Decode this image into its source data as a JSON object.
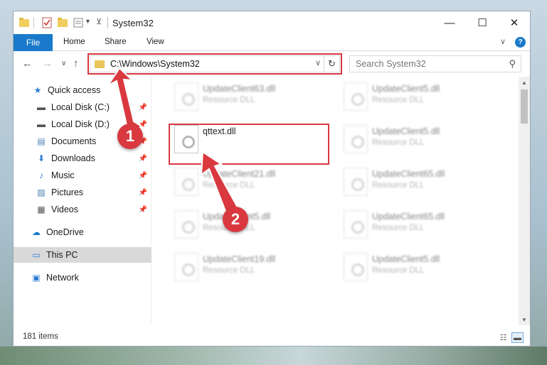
{
  "window": {
    "title": "System32",
    "minimize_glyph": "—",
    "maximize_glyph": "☐",
    "close_glyph": "✕"
  },
  "ribbon": {
    "tabs": [
      "File",
      "Home",
      "Share",
      "View"
    ],
    "expand_glyph": "∨",
    "help_glyph": "?"
  },
  "nav": {
    "back": "←",
    "forward": "→",
    "recent": "∨",
    "up": "↑"
  },
  "address": {
    "path": "C:\\Windows\\System32",
    "dropdown_glyph": "∨",
    "refresh_glyph": "↻"
  },
  "search": {
    "placeholder": "Search System32",
    "icon_glyph": "⚲"
  },
  "sidebar": {
    "items": [
      {
        "label": "Quick access",
        "icon": "star-icon",
        "glyph": "★",
        "color": "#2b7cd3",
        "pinned": false
      },
      {
        "label": "Local Disk (C:)",
        "icon": "drive-icon",
        "glyph": "▬",
        "color": "#555555",
        "pinned": true
      },
      {
        "label": "Local Disk (D:)",
        "icon": "drive-icon",
        "glyph": "▬",
        "color": "#555555",
        "pinned": true
      },
      {
        "label": "Documents",
        "icon": "documents-icon",
        "glyph": "▤",
        "color": "#4a7fb5",
        "pinned": true
      },
      {
        "label": "Downloads",
        "icon": "downloads-icon",
        "glyph": "⬇",
        "color": "#2b7cd3",
        "pinned": true
      },
      {
        "label": "Music",
        "icon": "music-icon",
        "glyph": "♪",
        "color": "#2b7cd3",
        "pinned": true
      },
      {
        "label": "Pictures",
        "icon": "pictures-icon",
        "glyph": "▨",
        "color": "#4a7fb5",
        "pinned": true
      },
      {
        "label": "Videos",
        "icon": "videos-icon",
        "glyph": "▦",
        "color": "#555555",
        "pinned": true
      },
      {
        "label": "OneDrive",
        "icon": "onedrive-icon",
        "glyph": "☁",
        "color": "#1979ca",
        "pinned": false
      },
      {
        "label": "This PC",
        "icon": "computer-icon",
        "glyph": "▭",
        "color": "#2b7cd3",
        "pinned": false,
        "selected": true
      },
      {
        "label": "Network",
        "icon": "network-icon",
        "glyph": "▣",
        "color": "#2b7cd3",
        "pinned": false
      }
    ],
    "pin_glyph": "📌"
  },
  "files": [
    {
      "name": "UpdateClient63.dll",
      "type": "Resource DLL",
      "blurred": true
    },
    {
      "name": "UpdateClient5.dll",
      "type": "Resource DLL",
      "blurred": true
    },
    {
      "name": "qttext.dll",
      "type": "",
      "blurred": false,
      "highlighted": true
    },
    {
      "name": "UpdateClient5.dll",
      "type": "Resource DLL",
      "blurred": true
    },
    {
      "name": "UpdateClient21.dll",
      "type": "Resource DLL",
      "blurred": true
    },
    {
      "name": "UpdateClient65.dll",
      "type": "Resource DLL",
      "blurred": true
    },
    {
      "name": "UpdateClient5.dll",
      "type": "Resource DLL",
      "blurred": true
    },
    {
      "name": "UpdateClient65.dll",
      "type": "Resource DLL",
      "blurred": true
    },
    {
      "name": "UpdateClient19.dll",
      "type": "Resource DLL",
      "blurred": true
    },
    {
      "name": "UpdateClient5.dll",
      "type": "Resource DLL",
      "blurred": true
    }
  ],
  "status": {
    "count": "181 items"
  },
  "callouts": [
    "1",
    "2"
  ],
  "colors": {
    "accent": "#1979ca",
    "annotation_red": "#d9383f"
  }
}
